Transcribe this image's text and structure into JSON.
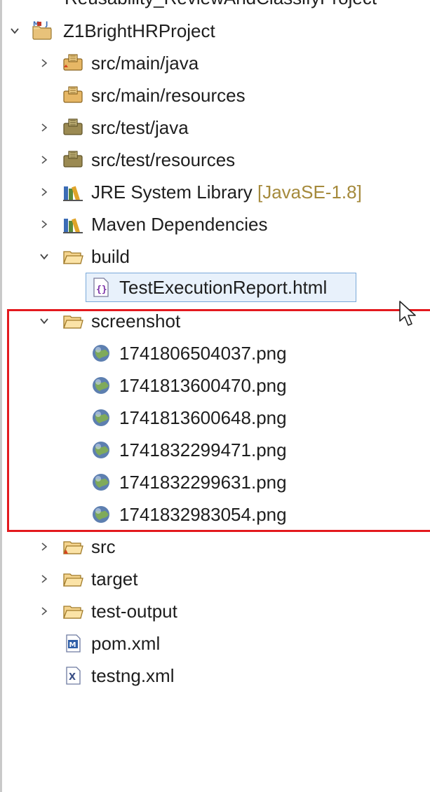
{
  "tree": {
    "cut_label": "Reusability_ReviewAndClassifyProject",
    "project": {
      "label": "Z1BrightHRProject",
      "icon": "maven-project-icon"
    },
    "items": [
      {
        "label": "src/main/java",
        "icon": "source-package-icon",
        "expander": "collapsed"
      },
      {
        "label": "src/main/resources",
        "icon": "source-package-icon",
        "expander": "none"
      },
      {
        "label": "src/test/java",
        "icon": "test-package-icon",
        "expander": "collapsed"
      },
      {
        "label": "src/test/resources",
        "icon": "test-package-icon",
        "expander": "collapsed"
      },
      {
        "label": "JRE System Library",
        "decoration": "[JavaSE-1.8]",
        "icon": "library-icon",
        "expander": "collapsed"
      },
      {
        "label": "Maven Dependencies",
        "icon": "library-icon",
        "expander": "collapsed"
      },
      {
        "label": "build",
        "icon": "folder-icon",
        "expander": "expanded"
      },
      {
        "label": "TestExecutionReport.html",
        "icon": "html-file-icon",
        "selected": true
      },
      {
        "label": "screenshot",
        "icon": "folder-icon",
        "expander": "expanded"
      },
      {
        "label": "1741806504037.png",
        "icon": "globe-icon"
      },
      {
        "label": "1741813600470.png",
        "icon": "globe-icon"
      },
      {
        "label": "1741813600648.png",
        "icon": "globe-icon"
      },
      {
        "label": "1741832299471.png",
        "icon": "globe-icon"
      },
      {
        "label": "1741832299631.png",
        "icon": "globe-icon"
      },
      {
        "label": "1741832983054.png",
        "icon": "globe-icon"
      },
      {
        "label": "src",
        "icon": "folder-icon",
        "expander": "collapsed"
      },
      {
        "label": "target",
        "icon": "folder-icon",
        "expander": "collapsed"
      },
      {
        "label": "test-output",
        "icon": "folder-icon",
        "expander": "collapsed"
      },
      {
        "label": "pom.xml",
        "icon": "maven-file-icon"
      },
      {
        "label": "testng.xml",
        "icon": "xml-file-icon"
      }
    ]
  },
  "colors": {
    "highlight_border": "#e3191e",
    "selection_bg": "#e8f1fb",
    "selection_border": "#7aa9d9",
    "decoration_text": "#a58a3c"
  }
}
